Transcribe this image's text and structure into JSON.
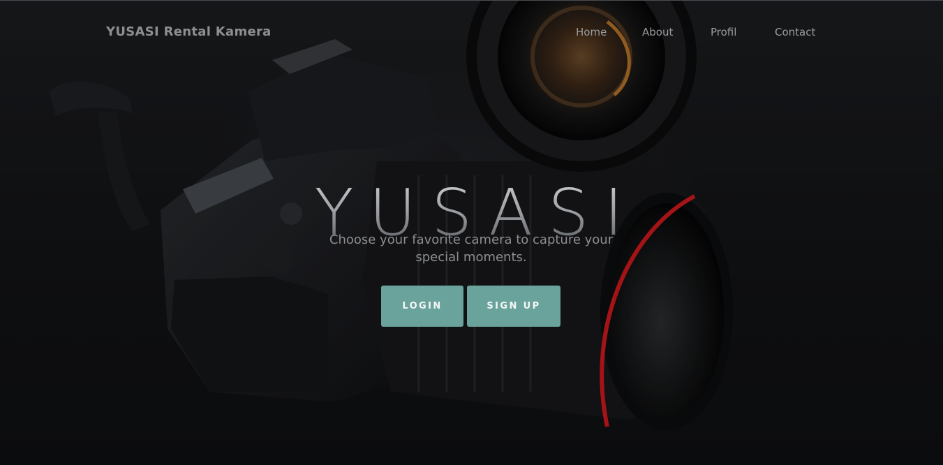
{
  "navbar": {
    "brand": "YUSASI Rental Kamera",
    "links": [
      {
        "label": "Home"
      },
      {
        "label": "About"
      },
      {
        "label": "Profil"
      },
      {
        "label": "Contact"
      }
    ]
  },
  "hero": {
    "background_image": "camera-photo",
    "title": "YUSASI",
    "subtitle": "Choose your favorite camera to capture your special moments.",
    "buttons": {
      "login": "LOGIN",
      "signup": "SIGN UP"
    }
  },
  "colors": {
    "button_bg": "#6aa39c",
    "button_text": "#f3f7f6",
    "nav_text": "#9a9c9f",
    "background": "#131416",
    "lens_accent_red": "#c8181c"
  }
}
